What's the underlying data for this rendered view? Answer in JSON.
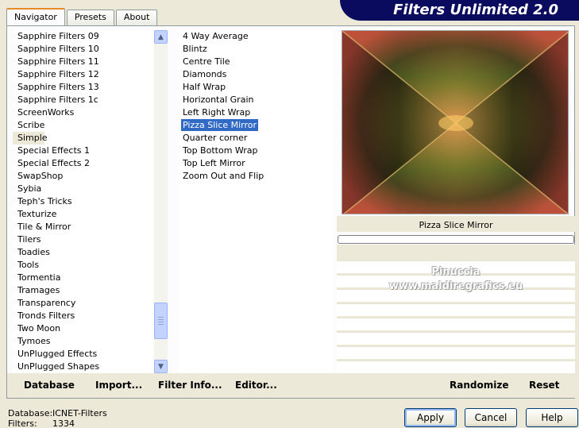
{
  "banner": {
    "title": "Filters Unlimited 2.0"
  },
  "tabs": [
    {
      "label": "Navigator",
      "active": true
    },
    {
      "label": "Presets",
      "active": false
    },
    {
      "label": "About",
      "active": false
    }
  ],
  "categories": {
    "items": [
      "Sapphire Filters 09",
      "Sapphire Filters 10",
      "Sapphire Filters 11",
      "Sapphire Filters 12",
      "Sapphire Filters 13",
      "Sapphire Filters 1c",
      "ScreenWorks",
      "Scribe",
      "Simple",
      "Special Effects 1",
      "Special Effects 2",
      "SwapShop",
      "Sybia",
      "Teph's Tricks",
      "Texturize",
      "Tile & Mirror",
      "Tilers",
      "Toadies",
      "Tools",
      "Tormentia",
      "Tramages",
      "Transparency",
      "Tronds Filters",
      "Two Moon",
      "Tymoes",
      "UnPlugged Effects",
      "UnPlugged Shapes"
    ],
    "selected": "Simple"
  },
  "filters": {
    "items": [
      "4 Way Average",
      "Blintz",
      "Centre Tile",
      "Diamonds",
      "Half Wrap",
      "Horizontal Grain",
      "Left Right Wrap",
      "Pizza Slice Mirror",
      "Quarter corner",
      "Top Bottom Wrap",
      "Top Left Mirror",
      "Zoom Out and Flip"
    ],
    "selected": "Pizza Slice Mirror"
  },
  "preview": {
    "filter_name": "Pizza Slice Mirror"
  },
  "watermark": {
    "line1": "Pinuccia",
    "line2": "www.maldiregrafics.eu"
  },
  "actions": {
    "database": "Database",
    "import": "Import...",
    "filter_info": "Filter Info...",
    "editor": "Editor...",
    "randomize": "Randomize",
    "reset": "Reset"
  },
  "status": {
    "database_label": "Database:",
    "database_value": "ICNET-Filters",
    "filters_label": "Filters:",
    "filters_value": "1334"
  },
  "buttons": {
    "apply": "Apply",
    "cancel": "Cancel",
    "help": "Help"
  },
  "colors": {
    "selection": "#316ac5",
    "banner": "#0a0a5e",
    "window": "#ece9d8"
  }
}
